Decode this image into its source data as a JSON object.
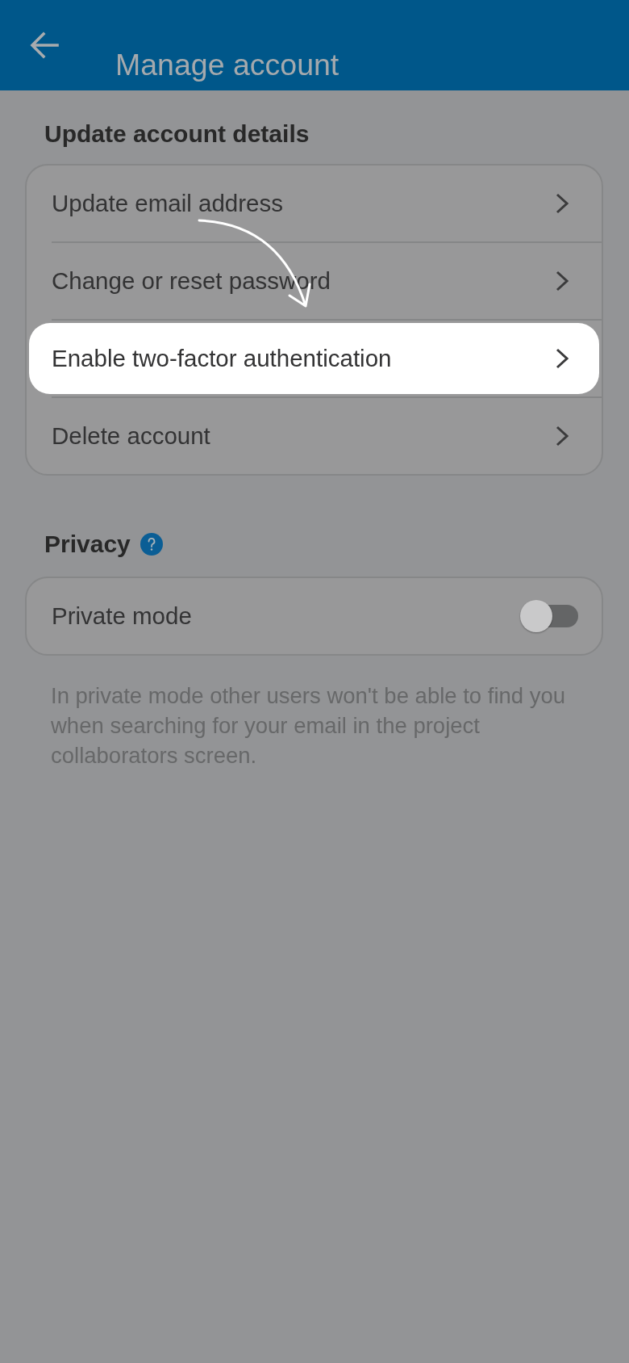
{
  "header": {
    "title": "Manage account"
  },
  "account_section": {
    "heading": "Update account details",
    "items": [
      {
        "label": "Update email address",
        "highlighted": false
      },
      {
        "label": "Change or reset password",
        "highlighted": false
      },
      {
        "label": "Enable two-factor authentication",
        "highlighted": true
      },
      {
        "label": "Delete account",
        "highlighted": false
      }
    ]
  },
  "privacy_section": {
    "heading": "Privacy",
    "toggle": {
      "label": "Private mode",
      "on": false
    },
    "description": "In private mode other users won't be able to find you when searching for your email in the project collaborators screen."
  }
}
